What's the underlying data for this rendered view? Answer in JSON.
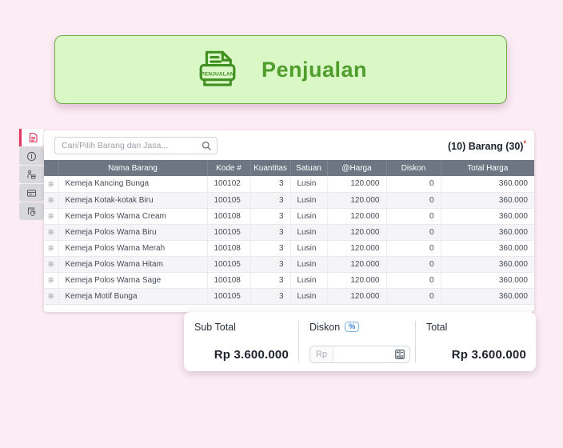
{
  "banner": {
    "title": "Penjualan",
    "icon_label": "PENJUALAN",
    "bg_color": "#daf7c6",
    "border_color": "#74ab4b",
    "text_color": "#4f9d2c"
  },
  "sidebar": {
    "items": [
      {
        "icon": "invoice-icon",
        "active": true,
        "accent_color": "#e4355f"
      },
      {
        "icon": "info-icon",
        "active": false
      },
      {
        "icon": "courier-icon",
        "active": false
      },
      {
        "icon": "card-icon",
        "active": false
      },
      {
        "icon": "return-doc-icon",
        "active": false
      }
    ]
  },
  "toolbar": {
    "search_placeholder": "Cari/Pilih Barang dan Jasa...",
    "count_text": "(10) Barang (30)",
    "count_marker": "*"
  },
  "table": {
    "columns": [
      "",
      "Nama Barang",
      "Kode #",
      "Kuantitas",
      "Satuan",
      "@Harga",
      "Diskon",
      "Total Harga"
    ],
    "header_bg": "#6d7682",
    "rows": [
      {
        "nama": "Kemeja Kancing Bunga",
        "kode": "100102",
        "kuantitas": "3",
        "satuan": "Lusin",
        "harga": "120.000",
        "diskon": "0",
        "total": "360.000"
      },
      {
        "nama": "Kemeja Kotak-kotak Biru",
        "kode": "100105",
        "kuantitas": "3",
        "satuan": "Lusin",
        "harga": "120.000",
        "diskon": "0",
        "total": "360.000"
      },
      {
        "nama": "Kemeja Polos Warna Cream",
        "kode": "100108",
        "kuantitas": "3",
        "satuan": "Lusin",
        "harga": "120.000",
        "diskon": "0",
        "total": "360.000"
      },
      {
        "nama": "Kemeja Polos Warna Biru",
        "kode": "100105",
        "kuantitas": "3",
        "satuan": "Lusin",
        "harga": "120.000",
        "diskon": "0",
        "total": "360.000"
      },
      {
        "nama": "Kemeja Polos Warna Merah",
        "kode": "100108",
        "kuantitas": "3",
        "satuan": "Lusin",
        "harga": "120.000",
        "diskon": "0",
        "total": "360.000"
      },
      {
        "nama": "Kemeja Polos Warna Hitam",
        "kode": "100105",
        "kuantitas": "3",
        "satuan": "Lusin",
        "harga": "120.000",
        "diskon": "0",
        "total": "360.000"
      },
      {
        "nama": "Kemeja Polos Warna Sage",
        "kode": "100108",
        "kuantitas": "3",
        "satuan": "Lusin",
        "harga": "120.000",
        "diskon": "0",
        "total": "360.000"
      },
      {
        "nama": "Kemeja Motif Bunga",
        "kode": "100105",
        "kuantitas": "3",
        "satuan": "Lusin",
        "harga": "120.000",
        "diskon": "0",
        "total": "360.000"
      }
    ]
  },
  "summary": {
    "sub_total_label": "Sub Total",
    "sub_total_value": "Rp 3.600.000",
    "diskon_label": "Diskon",
    "diskon_badge": "%",
    "diskon_prefix": "Rp",
    "diskon_value": "",
    "total_label": "Total",
    "total_value": "Rp 3.600.000"
  }
}
